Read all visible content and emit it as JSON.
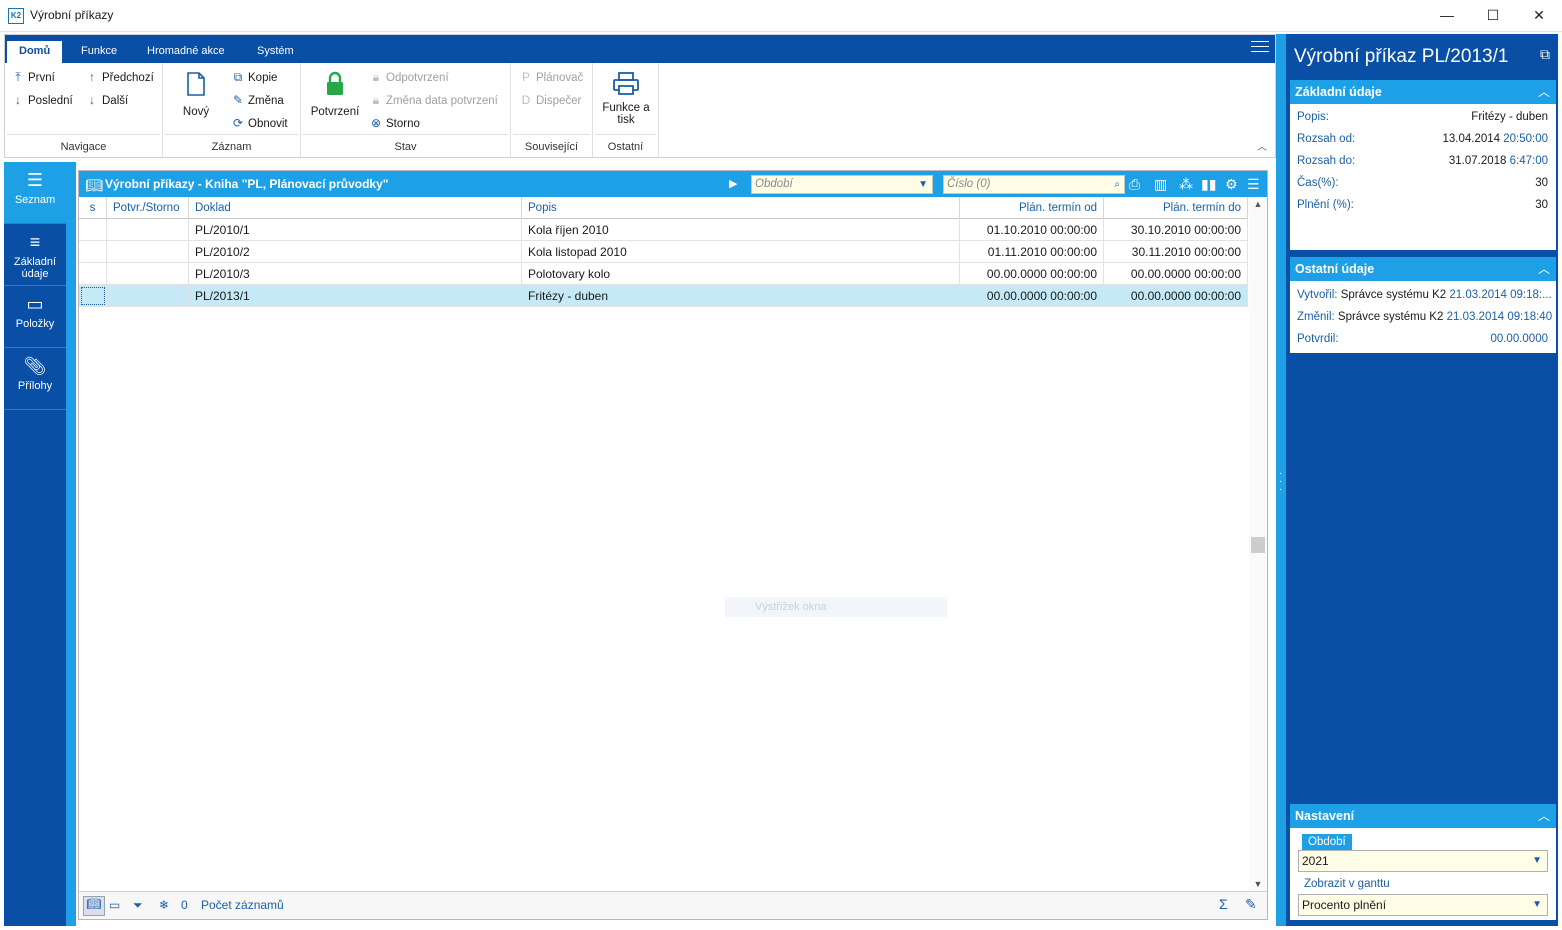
{
  "window": {
    "title": "Výrobní příkazy",
    "logo": "K2",
    "controls": [
      "—",
      "☐",
      "✕"
    ]
  },
  "ribbon": {
    "tabs": [
      "Domů",
      "Funkce",
      "Hromadné akce",
      "Systém"
    ],
    "active_tab": "Domů",
    "groups": {
      "navigace": {
        "label": "Navigace",
        "prvni": "První",
        "posledni": "Poslední",
        "predchozi": "Předchozí",
        "dalsi": "Další"
      },
      "zaznam": {
        "label": "Záznam",
        "novy": "Nový",
        "kopie": "Kopie",
        "zmena": "Změna",
        "obnovit": "Obnovit"
      },
      "stav": {
        "label": "Stav",
        "potvrzeni": "Potvrzení",
        "odpotvrzeni": "Odpotvrzení",
        "zmena_data": "Změna data potvrzení",
        "storno": "Storno"
      },
      "souvisejici": {
        "label": "Související",
        "planovac": "Plánovač",
        "dispecer": "Dispečer"
      },
      "ostatni": {
        "label": "Ostatní",
        "funkce_tisk_1": "Funkce a",
        "funkce_tisk_2": "tisk"
      }
    }
  },
  "leftnav": {
    "items": [
      {
        "label": "Seznam",
        "active": true
      },
      {
        "label1": "Základní",
        "label2": "údaje"
      },
      {
        "label": "Položky"
      },
      {
        "label": "Přílohy"
      }
    ]
  },
  "grid": {
    "title": "Výrobní příkazy - Kniha \"PL, Plánovací průvodky\"",
    "obdobi_placeholder": "Období",
    "cislo_placeholder": "Číslo (0)",
    "columns": [
      "s",
      "Potvr./Storno",
      "Doklad",
      "Popis",
      "Plán. termín od",
      "Plán. termín do"
    ],
    "rows": [
      {
        "s": "",
        "potvr": "",
        "doklad": "PL/2010/1",
        "popis": "Kola říjen 2010",
        "od": "01.10.2010 00:00:00",
        "do": "30.10.2010 00:00:00",
        "selected": false
      },
      {
        "s": "",
        "potvr": "",
        "doklad": "PL/2010/2",
        "popis": "Kola listopad 2010",
        "od": "01.11.2010 00:00:00",
        "do": "30.11.2010 00:00:00",
        "selected": false
      },
      {
        "s": "",
        "potvr": "",
        "doklad": "PL/2010/3",
        "popis": "Polotovary kolo",
        "od": "00.00.0000 00:00:00",
        "do": "00.00.0000 00:00:00",
        "selected": false
      },
      {
        "s": "",
        "potvr": "",
        "doklad": "PL/2013/1",
        "popis": "Fritézy - duben",
        "od": "00.00.0000 00:00:00",
        "do": "00.00.0000 00:00:00",
        "selected": true
      }
    ],
    "ghost_text": "Výstřižek okna",
    "status": {
      "count": "0",
      "pocet_label": "Počet záznamů"
    }
  },
  "right_panel": {
    "title": "Výrobní příkaz PL/2013/1",
    "zakladni": {
      "header": "Základní údaje",
      "popis_label": "Popis:",
      "popis_value": "Fritézy - duben",
      "rozsah_od_label": "Rozsah od:",
      "rozsah_od_date": "13.04.2014",
      "rozsah_od_time": "20:50:00",
      "rozsah_do_label": "Rozsah do:",
      "rozsah_do_date": "31.07.2018",
      "rozsah_do_time": "6:47:00",
      "cas_label": "Čas(%):",
      "cas_value": "30",
      "plneni_label": "Plnění (%):",
      "plneni_value": "30"
    },
    "ostatni": {
      "header": "Ostatní údaje",
      "vytvoril_label": "Vytvořil:",
      "vytvoril_name": "Správce systému K2",
      "vytvoril_date": "21.03.2014 09:18:...",
      "zmenil_label": "Změnil:",
      "zmenil_name": "Správce systému K2",
      "zmenil_date": "21.03.2014 09:18:40",
      "potvrdil_label": "Potvrdil:",
      "potvrdil_date": "00.00.0000"
    },
    "nastaveni": {
      "header": "Nastavení",
      "obdobi_label": "Období",
      "obdobi_value": "2021",
      "gantt_label": "Zobrazit v ganttu",
      "gantt_value": "Procento plnění"
    }
  },
  "colors": {
    "dark_blue": "#0a4fa6",
    "light_blue": "#1ea0e6",
    "selection": "#c6e9f8",
    "input_bg": "#fffde6"
  }
}
